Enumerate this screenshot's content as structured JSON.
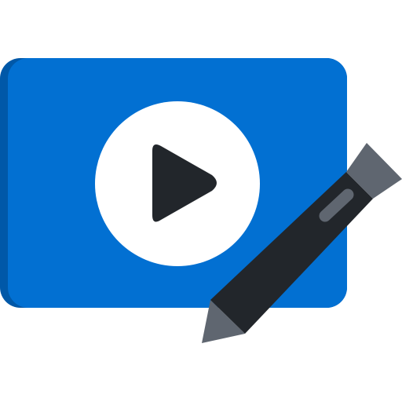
{
  "icon": {
    "name": "video-edit-icon",
    "colors": {
      "panel": "#0270D2",
      "panel_shadow": "#0058A8",
      "play_circle": "#FFFFFF",
      "play_triangle": "#22262B",
      "pen_body": "#22262B",
      "pen_cap": "#5F6670",
      "pen_highlight": "#5F6670",
      "pen_tip": "#5F6670"
    }
  }
}
